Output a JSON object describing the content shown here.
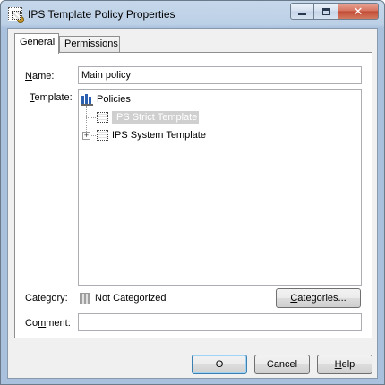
{
  "window": {
    "title": "IPS Template Policy Properties",
    "caption": {
      "minimize": "minimize",
      "maximize": "maximize",
      "close": "✕"
    }
  },
  "tabs": [
    {
      "label": "General",
      "active": true
    },
    {
      "label": "Permissions",
      "active": false
    }
  ],
  "form": {
    "name_label": "Name:",
    "name_value": "Main policy",
    "template_label": "Template:",
    "category_label": "Category:",
    "category_value": "Not Categorized",
    "comment_label": "Comment:",
    "comment_value": "",
    "categories_button": "Categories..."
  },
  "tree": {
    "root": {
      "label": "Policies",
      "icon": "policies-icon"
    },
    "children": [
      {
        "label": "IPS Strict Template",
        "icon": "template-icon",
        "selected": true,
        "expandable": false
      },
      {
        "label": "IPS System Template",
        "icon": "template-icon",
        "selected": false,
        "expandable": true
      }
    ]
  },
  "buttons": {
    "ok": "O",
    "cancel": "Cancel",
    "help": "Help"
  },
  "colors": {
    "selection_bg": "#cfcfcf",
    "title_gradient": "#bcd0e6",
    "close_button": "#c24a33"
  }
}
